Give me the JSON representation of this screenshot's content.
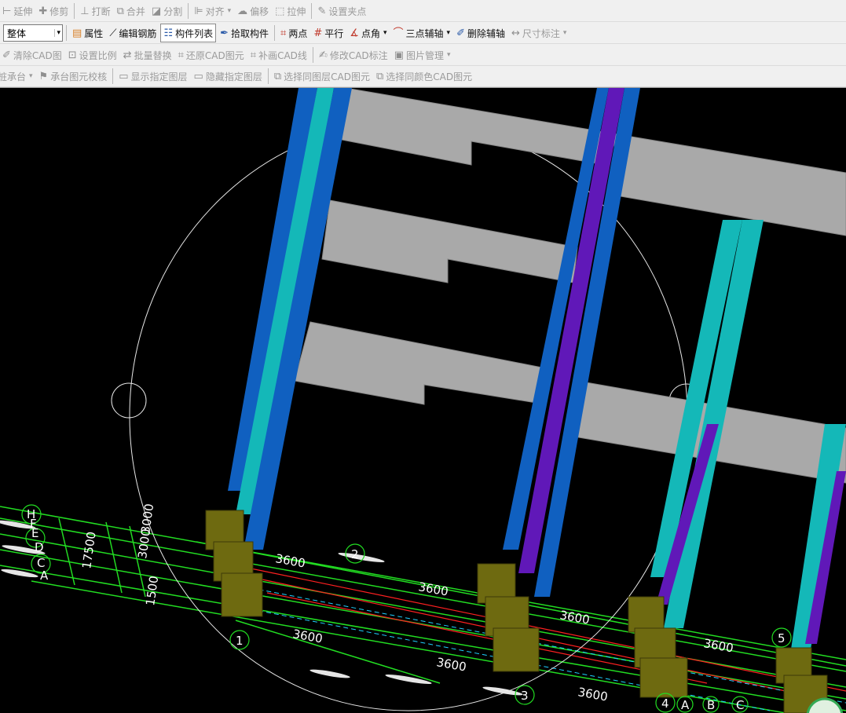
{
  "toolbar1": {
    "extend": "延伸",
    "trim": "修剪",
    "break": "打断",
    "merge": "合并",
    "split": "分割",
    "align": "对齐",
    "offset": "偏移",
    "stretch": "拉伸",
    "set_grip": "设置夹点"
  },
  "toolbar2": {
    "scope_value": "整体",
    "properties": "属性",
    "edit_rebar": "编辑钢筋",
    "component_list": "构件列表",
    "pick_component": "拾取构件",
    "two_points": "两点",
    "parallel": "平行",
    "point_angle": "点角",
    "three_point_axis": "三点辅轴",
    "delete_axis": "删除辅轴",
    "dimension": "尺寸标注"
  },
  "toolbar3": {
    "clear_cad": "清除CAD图",
    "set_scale": "设置比例",
    "batch_replace": "批量替换",
    "restore_cad": "还原CAD图元",
    "draw_cad_line": "补画CAD线",
    "modify_cad_label": "修改CAD标注",
    "image_manage": "图片管理"
  },
  "toolbar4": {
    "pile_cap": "桩承台",
    "cap_check": "承台图元校核",
    "show_layer": "显示指定图层",
    "hide_layer": "隐藏指定图层",
    "select_same_layer": "选择同图层CAD图元",
    "select_same_color": "选择同颜色CAD图元"
  },
  "drawing": {
    "dims_top": [
      "3600",
      "3600",
      "3600",
      "3600"
    ],
    "dims_bottom": [
      "3600",
      "3600",
      "3600"
    ],
    "dims_left": [
      "17500",
      "1500",
      "3000",
      "3000"
    ],
    "axis_numbers": [
      "1",
      "2",
      "3",
      "4",
      "5"
    ],
    "axis_letters_left": [
      "H",
      "F",
      "E",
      "D",
      "C",
      "A"
    ],
    "axis_letters_bottom": [
      "A",
      "B",
      "C"
    ]
  },
  "colors": {
    "background": "#000000",
    "beam": "#a9a9a9",
    "column_blue": "#1060c0",
    "column_cyan": "#14b8b8",
    "column_purple": "#6018b8",
    "footing": "#6e6a10",
    "grid_green": "#22dd22",
    "grid_red": "#ff2020"
  },
  "icons": {
    "extend": "extend-icon",
    "trim": "trim-icon",
    "break": "break-icon",
    "merge": "merge-icon",
    "split": "split-icon",
    "align": "align-icon",
    "offset": "offset-icon",
    "stretch": "stretch-icon",
    "set_grip": "pencil-icon",
    "properties": "properties-icon",
    "edit_rebar": "rebar-icon",
    "component_list": "list-icon",
    "pick_component": "eyedropper-icon",
    "two_points": "axis-icon",
    "parallel": "parallel-icon",
    "point_angle": "angle-icon",
    "three_point_axis": "arc-axis-icon",
    "delete_axis": "eraser-icon",
    "dimension": "dimension-icon"
  }
}
